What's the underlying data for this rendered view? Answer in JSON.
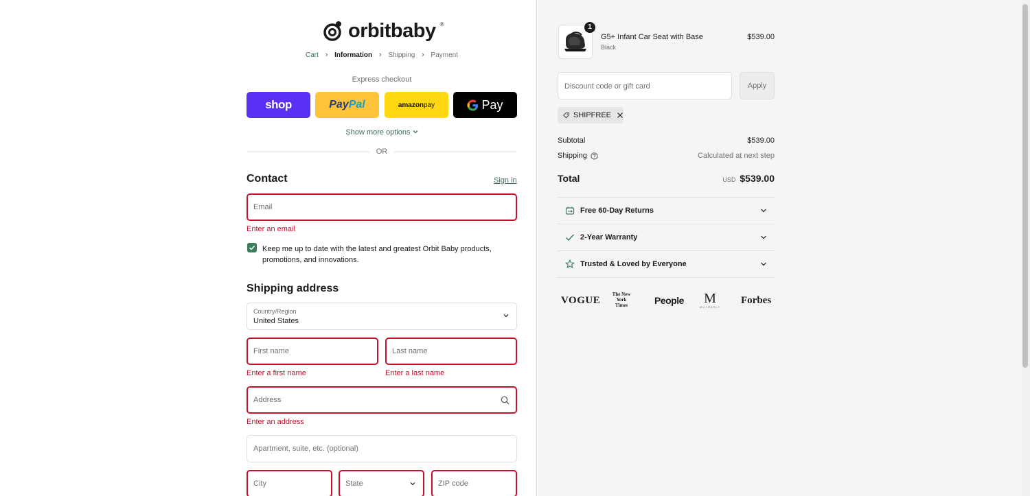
{
  "brand": {
    "logo_text": "orbitbaby"
  },
  "breadcrumbs": [
    {
      "label": "Cart",
      "state": "link"
    },
    {
      "label": "Information",
      "state": "active"
    },
    {
      "label": "Shipping",
      "state": "inactive"
    },
    {
      "label": "Payment",
      "state": "inactive"
    }
  ],
  "express": {
    "title": "Express checkout",
    "shop_label": "shop",
    "paypal_label_a": "Pay",
    "paypal_label_b": "Pal",
    "amazon_label_a": "amazon",
    "amazon_label_b": " pay",
    "gpay_label": "Pay",
    "show_more": "Show more options"
  },
  "divider_text": "OR",
  "contact": {
    "heading": "Contact",
    "sign_in": "Sign in",
    "email_placeholder": "Email",
    "email_error": "Enter an email",
    "marketing_checked": true,
    "marketing_label": "Keep me up to date with the latest and greatest Orbit Baby products, promotions, and innovations."
  },
  "shipping": {
    "heading": "Shipping address",
    "country_label": "Country/Region",
    "country_value": "United States",
    "first_name_placeholder": "First name",
    "first_name_error": "Enter a first name",
    "last_name_placeholder": "Last name",
    "last_name_error": "Enter a last name",
    "address_placeholder": "Address",
    "address_error": "Enter an address",
    "apartment_placeholder": "Apartment, suite, etc. (optional)",
    "city_placeholder": "City",
    "state_placeholder": "State",
    "zip_placeholder": "ZIP code"
  },
  "order": {
    "item": {
      "name": "G5+ Infant Car Seat with Base",
      "variant": "Black",
      "price": "$539.00",
      "quantity": "1"
    },
    "discount_placeholder": "Discount code or gift card",
    "apply_label": "Apply",
    "applied_code": "SHIPFREE",
    "subtotal_label": "Subtotal",
    "subtotal_value": "$539.00",
    "shipping_label": "Shipping",
    "shipping_value": "Calculated at next step",
    "total_label": "Total",
    "currency": "USD",
    "total_value": "$539.00"
  },
  "perks": [
    {
      "label": "Free 60-Day Returns",
      "icon": "returns-icon"
    },
    {
      "label": "2-Year Warranty",
      "icon": "check-icon"
    },
    {
      "label": "Trusted & Loved by Everyone",
      "icon": "star-icon"
    }
  ],
  "press": {
    "vogue": "VOGUE",
    "nyt": "The New York Times",
    "people": "People",
    "motherly_m": "M",
    "motherly_name": "MOTHERLY",
    "forbes": "Forbes"
  },
  "colors": {
    "accent_green": "#3a6e55",
    "error_red": "#c8102e",
    "shop_purple": "#5a31f4",
    "paypal_yellow": "#ffc439",
    "amazon_yellow": "#ffd814"
  }
}
